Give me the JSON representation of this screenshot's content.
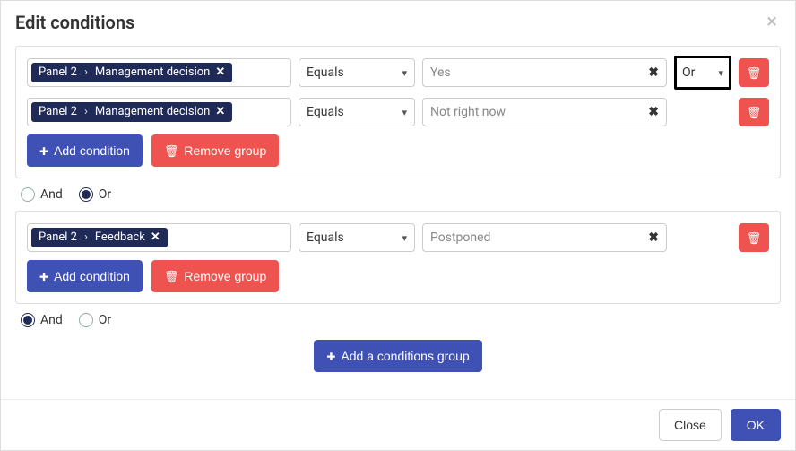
{
  "dialog": {
    "title": "Edit conditions"
  },
  "groups": [
    {
      "conditions": [
        {
          "field_panel": "Panel 2",
          "field_name": "Management decision",
          "operator": "Equals",
          "value": "Yes",
          "logic": "Or",
          "show_logic": true
        },
        {
          "field_panel": "Panel 2",
          "field_name": "Management decision",
          "operator": "Equals",
          "value": "Not right now",
          "show_logic": false
        }
      ]
    },
    {
      "conditions": [
        {
          "field_panel": "Panel 2",
          "field_name": "Feedback",
          "operator": "Equals",
          "value": "Postponed",
          "show_logic": false
        }
      ]
    }
  ],
  "between": [
    {
      "selected": "Or",
      "and_label": "And",
      "or_label": "Or"
    },
    {
      "selected": "And",
      "and_label": "And",
      "or_label": "Or"
    }
  ],
  "buttons": {
    "add_condition": "Add condition",
    "remove_group": "Remove group",
    "add_group": "Add a conditions group",
    "close": "Close",
    "ok": "OK"
  },
  "chip_separator": "›"
}
